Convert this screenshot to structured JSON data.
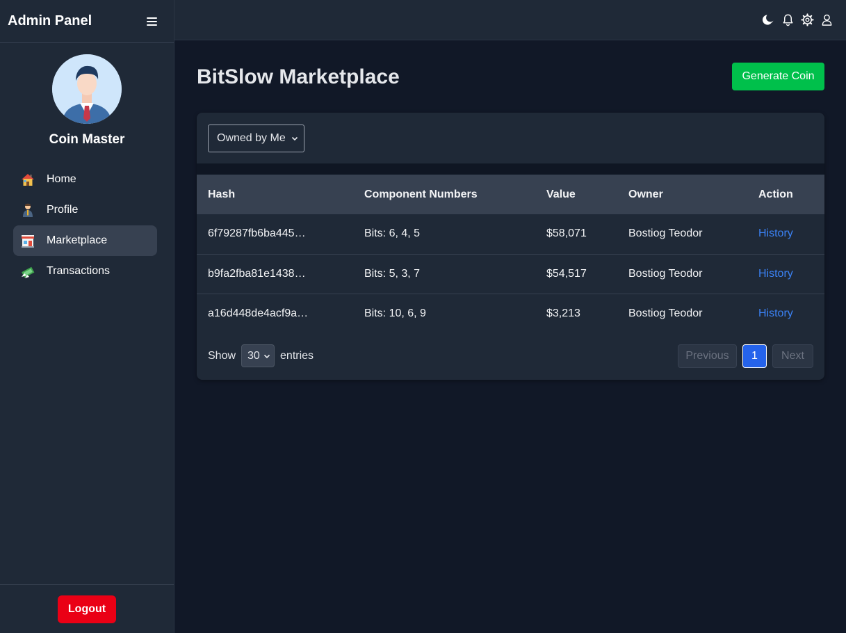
{
  "app": {
    "title": "Admin Panel"
  },
  "profile": {
    "name": "Coin Master"
  },
  "sidebar": {
    "items": [
      {
        "label": "Home",
        "icon": "house-icon"
      },
      {
        "label": "Profile",
        "icon": "person-icon"
      },
      {
        "label": "Marketplace",
        "icon": "store-icon",
        "active": true
      },
      {
        "label": "Transactions",
        "icon": "money-icon"
      }
    ],
    "logout_label": "Logout"
  },
  "topbar": {
    "icons": [
      "moon-icon",
      "bell-icon",
      "gear-icon",
      "user-icon"
    ]
  },
  "main": {
    "title": "BitSlow Marketplace",
    "generate_label": "Generate Coin",
    "filter": {
      "selected": "Owned by Me"
    },
    "table": {
      "headers": [
        "Hash",
        "Component Numbers",
        "Value",
        "Owner",
        "Action"
      ],
      "rows": [
        {
          "hash": "6f79287fb6ba445…",
          "components": "Bits: 6, 4, 5",
          "value": "$58,071",
          "owner": "Bostiog Teodor",
          "action": "History"
        },
        {
          "hash": "b9fa2fba81e1438…",
          "components": "Bits: 5, 3, 7",
          "value": "$54,517",
          "owner": "Bostiog Teodor",
          "action": "History"
        },
        {
          "hash": "a16d448de4acf9a…",
          "components": "Bits: 10, 6, 9",
          "value": "$3,213",
          "owner": "Bostiog Teodor",
          "action": "History"
        }
      ]
    },
    "footer": {
      "show_label": "Show",
      "entries_value": "30",
      "entries_label": "entries",
      "prev_label": "Previous",
      "page_label": "1",
      "next_label": "Next"
    }
  },
  "colors": {
    "accent_green": "#00c04b",
    "logout_red": "#ea0015",
    "link_blue": "#3b82f6",
    "page_active": "#2563eb"
  }
}
